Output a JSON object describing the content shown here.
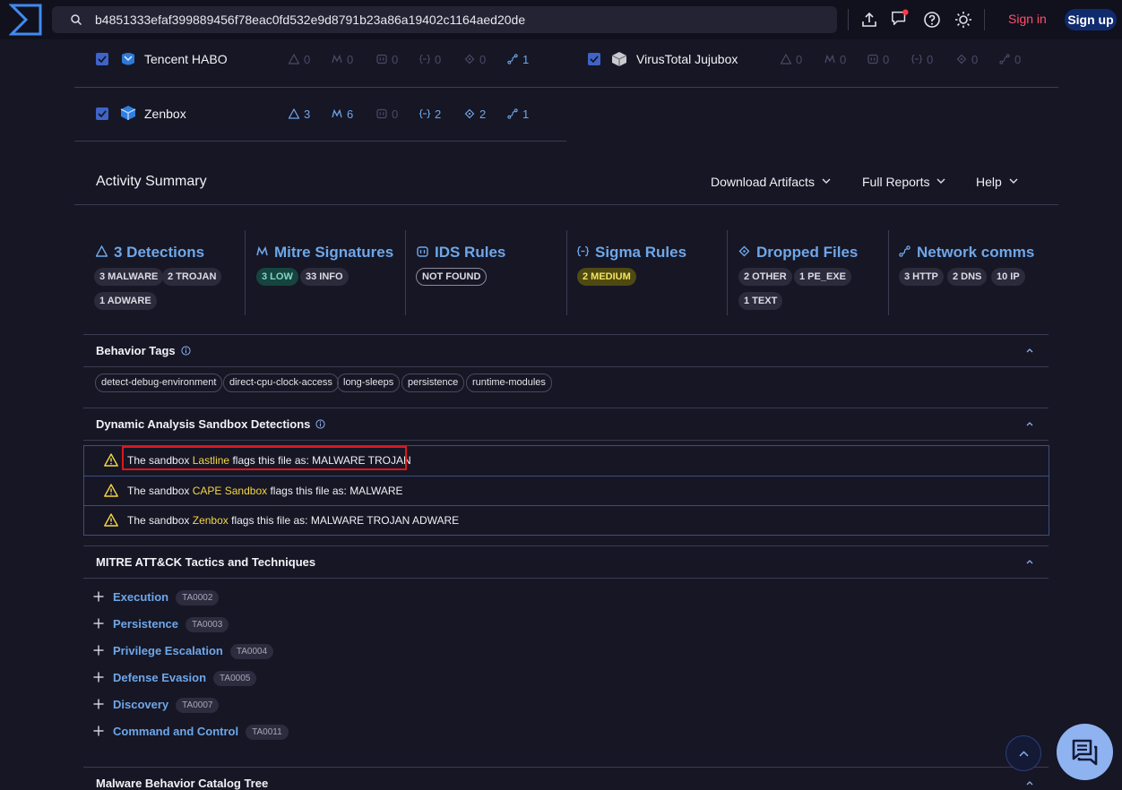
{
  "search": {
    "value": "b4851333efaf399889456f78eac0fd532e9d8791b23a86a19402c1164aed20de"
  },
  "auth": {
    "signin": "Sign in",
    "signup": "Sign up"
  },
  "sandboxes": [
    {
      "name": "Tencent HABO",
      "counts": [
        "0",
        "0",
        "0",
        "0",
        "0",
        "1"
      ]
    },
    {
      "name": "VirusTotal Jujubox",
      "counts": [
        "0",
        "0",
        "0",
        "0",
        "0",
        "0"
      ]
    },
    {
      "name": "Zenbox",
      "counts": [
        "3",
        "6",
        "0",
        "2",
        "2",
        "1"
      ]
    }
  ],
  "activity": {
    "title": "Activity Summary",
    "menus": [
      "Download Artifacts",
      "Full Reports",
      "Help"
    ]
  },
  "cards": [
    {
      "title": "3 Detections",
      "badges": [
        "3 MALWARE",
        "2 TROJAN",
        "1 ADWARE"
      ]
    },
    {
      "title": "Mitre Signatures",
      "badges": [
        "3 LOW",
        "33 INFO"
      ]
    },
    {
      "title": "IDS Rules",
      "badges": [
        "NOT FOUND"
      ]
    },
    {
      "title": "Sigma Rules",
      "badges": [
        "2 MEDIUM"
      ]
    },
    {
      "title": "Dropped Files",
      "badges": [
        "2 OTHER",
        "1 PE_EXE",
        "1 TEXT"
      ]
    },
    {
      "title": "Network comms",
      "badges": [
        "3 HTTP",
        "2 DNS",
        "10 IP"
      ]
    }
  ],
  "behavior_tags": {
    "title": "Behavior Tags",
    "tags": [
      "detect-debug-environment",
      "direct-cpu-clock-access",
      "long-sleeps",
      "persistence",
      "runtime-modules"
    ]
  },
  "detections": {
    "title": "Dynamic Analysis Sandbox Detections",
    "prefix": "The sandbox",
    "middle": "flags this file as:",
    "rows": [
      {
        "sandbox": "Lastline",
        "verdict": "MALWARE TROJAN"
      },
      {
        "sandbox": "CAPE Sandbox",
        "verdict": "MALWARE"
      },
      {
        "sandbox": "Zenbox",
        "verdict": "MALWARE TROJAN ADWARE"
      }
    ]
  },
  "mitre": {
    "title": "MITRE ATT&CK Tactics and Techniques",
    "tactics": [
      {
        "name": "Execution",
        "id": "TA0002"
      },
      {
        "name": "Persistence",
        "id": "TA0003"
      },
      {
        "name": "Privilege Escalation",
        "id": "TA0004"
      },
      {
        "name": "Defense Evasion",
        "id": "TA0005"
      },
      {
        "name": "Discovery",
        "id": "TA0007"
      },
      {
        "name": "Command and Control",
        "id": "TA0011"
      }
    ]
  },
  "mbc": {
    "title": "Malware Behavior Catalog Tree"
  },
  "colors": {
    "accent": "#6ea7e8",
    "sandbox_name": "#f5d742",
    "highlight": "#e0161b",
    "signin": "#ff4f6d"
  }
}
